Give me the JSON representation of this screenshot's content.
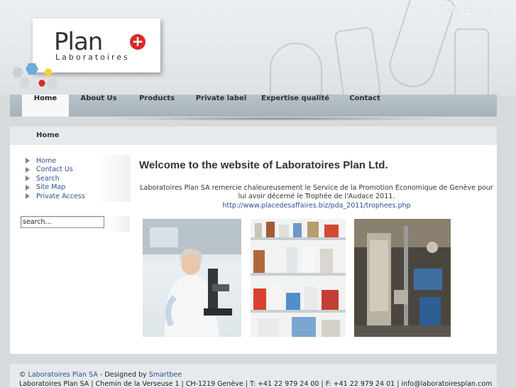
{
  "languages": [
    "EN",
    "FR",
    "DE"
  ],
  "logo": {
    "name": "Plan",
    "subtitle": "Laboratoires",
    "cross": "+"
  },
  "nav": [
    "Home",
    "About Us",
    "Products",
    "Private label",
    "Expertise qualité",
    "Contact"
  ],
  "breadcrumb": "Home",
  "sidebar": [
    "Home",
    "Contact Us",
    "Search",
    "Site Map",
    "Private Access"
  ],
  "search": {
    "value": "search..."
  },
  "main": {
    "title": "Welcome to the website of Laboratoires Plan Ltd.",
    "intro": "Laboratoires Plan SA remercie chaleureusement le Service de la Promotion Economique de Genève pour lui avoir décerné le Trophée de l'Audace 2011.",
    "link": "http://www.placedesaffaires.biz/pda_2011/trophees.php"
  },
  "footer": {
    "copyright": "©",
    "company_link": "Laboratoires Plan SA",
    "designed_by": "- Designed by",
    "designer_link": "Smartbee",
    "address": "Laboratoires Plan SA | Chemin de la Verseuse 1 | CH-1219 Genève | T: +41 22 979 24 00 | F: +41 22 979 24 01 | info@laboratoiresplan.com"
  },
  "colors": {
    "accent_red": "#d92b2b",
    "link_blue": "#2a4f9a",
    "nav_bg": "#a9b4bc"
  }
}
